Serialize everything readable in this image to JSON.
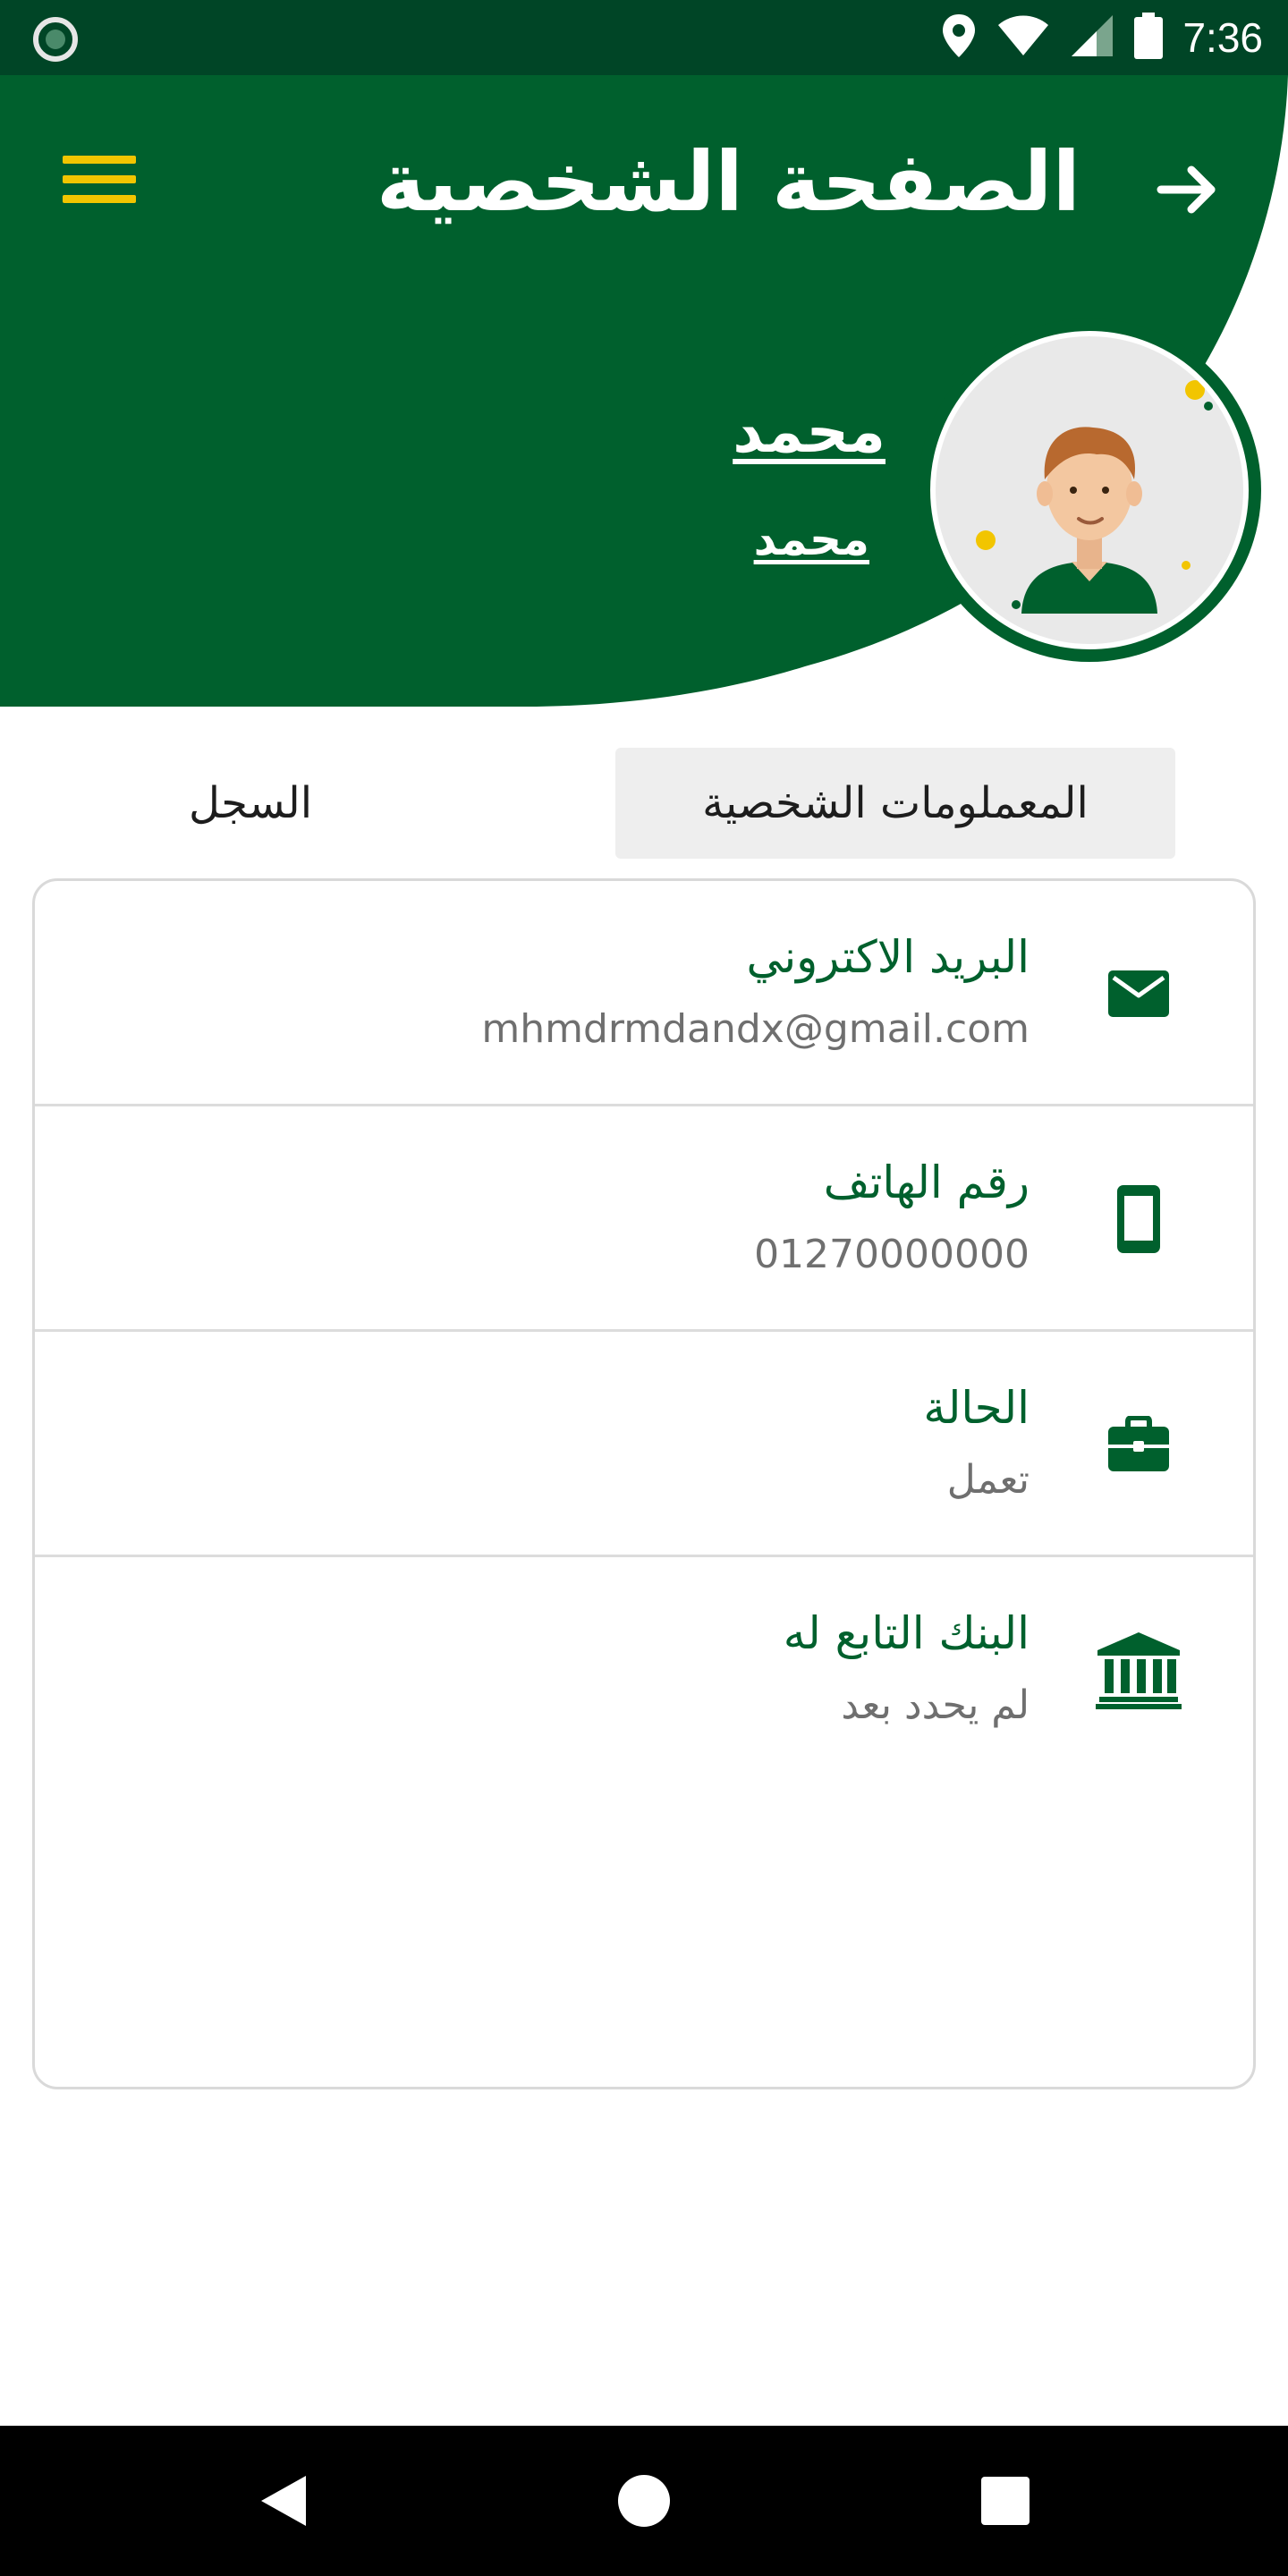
{
  "status_bar": {
    "time": "7:36"
  },
  "header": {
    "title": "الصفحة الشخصية",
    "user_name": "محمد",
    "user_subtitle": "محمد"
  },
  "tabs": [
    {
      "label": "المعملومات الشخصية",
      "active": true
    },
    {
      "label": "السجل",
      "active": false
    }
  ],
  "info_rows": [
    {
      "icon": "envelope-icon",
      "label": "البريد الاكتروني",
      "value": "mhmdrmdandx@gmail.com"
    },
    {
      "icon": "phone-icon",
      "label": "رقم الهاتف",
      "value": "01270000000"
    },
    {
      "icon": "briefcase-icon",
      "label": "الحالة",
      "value": "تعمل"
    },
    {
      "icon": "bank-icon",
      "label": "البنك التابع له",
      "value": "لم يحدد بعد"
    }
  ],
  "colors": {
    "primary": "#00602d",
    "status_bar": "#004526",
    "accent": "#f2c500"
  }
}
